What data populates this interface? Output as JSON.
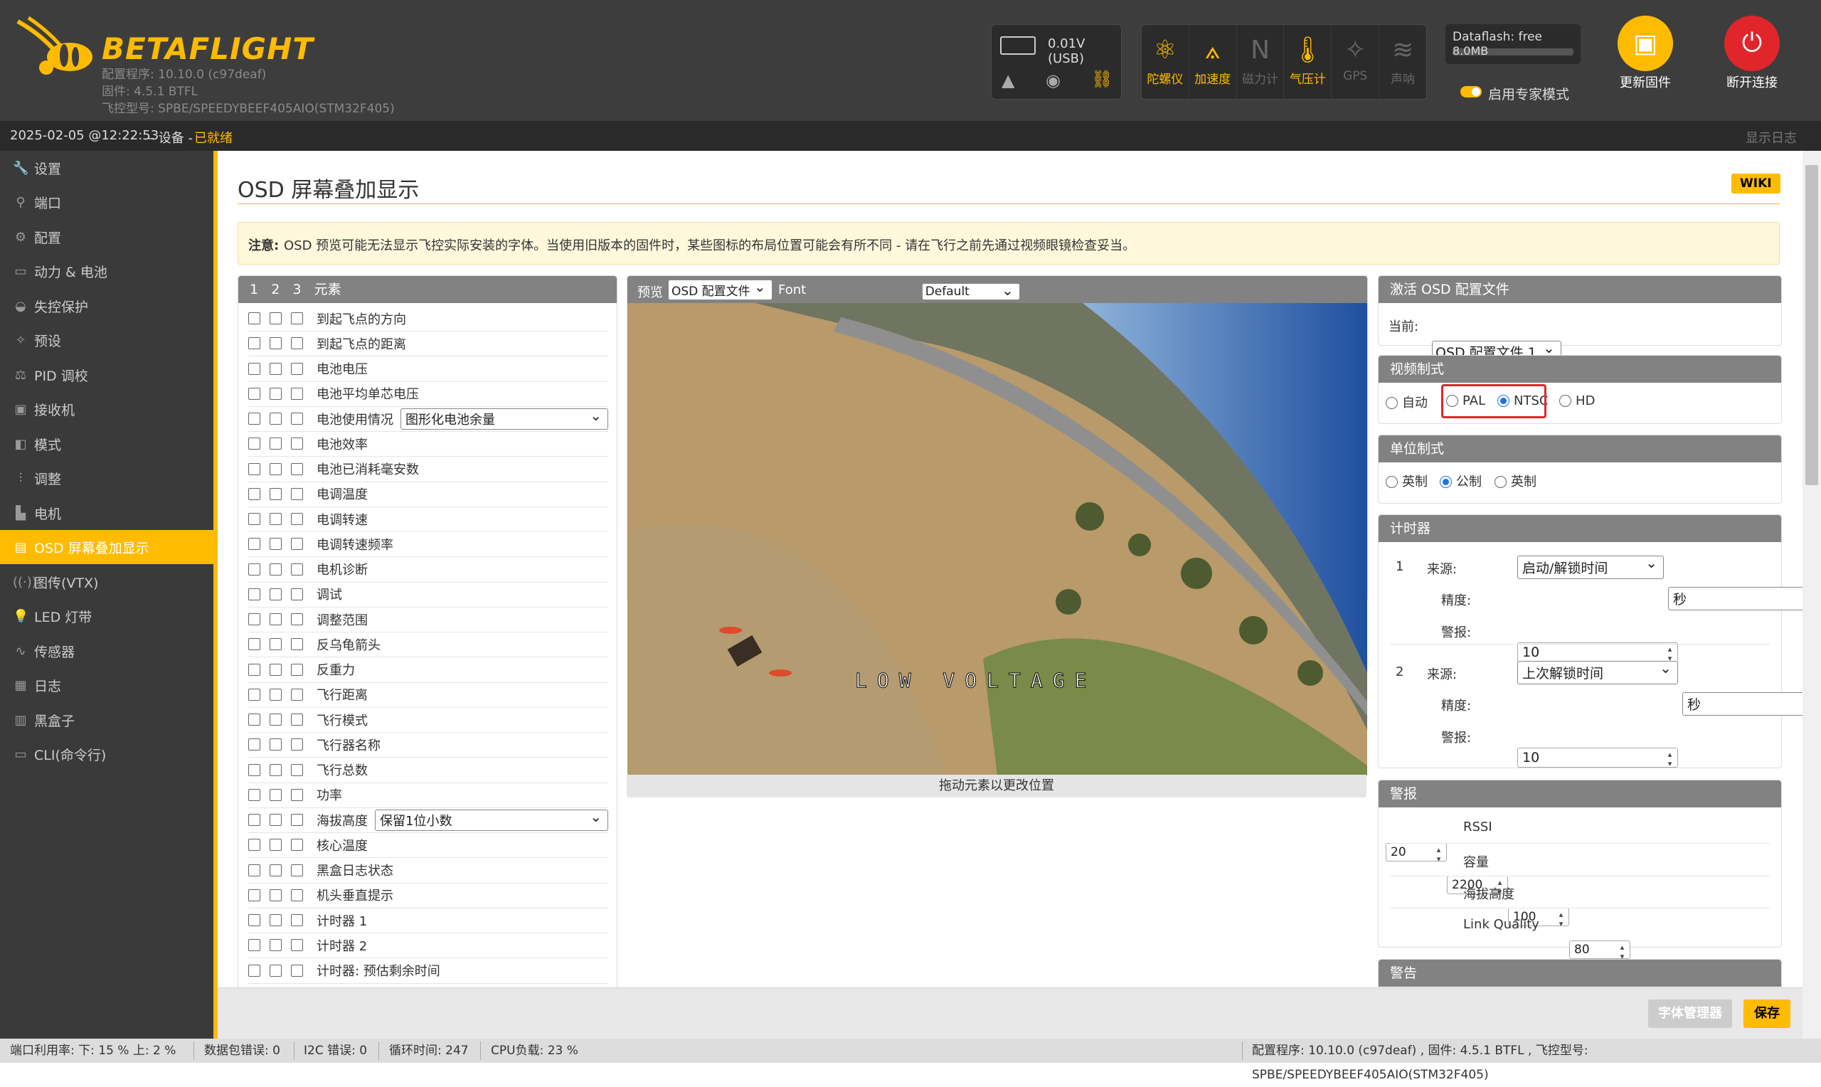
{
  "app": {
    "logo_text": "BETAFLIGHT",
    "configurator_version": "配置程序: 10.10.0 (c97deaf)",
    "firmware": "固件: 4.5.1 BTFL",
    "board": "飞控型号: SPBE/SPEEDYBEEF405AIO(STM32F405)"
  },
  "header": {
    "battery_voltage": "0.01V (USB)",
    "sensors": [
      {
        "label": "陀螺仪",
        "icon": "gyro-icon",
        "active": true
      },
      {
        "label": "加速度",
        "icon": "accelerometer-icon",
        "active": true
      },
      {
        "label": "磁力计",
        "icon": "magnetometer-icon",
        "active": false
      },
      {
        "label": "气压计",
        "icon": "barometer-icon",
        "active": true
      },
      {
        "label": "GPS",
        "icon": "gps-icon",
        "active": false
      },
      {
        "label": "声呐",
        "icon": "sonar-icon",
        "active": false
      }
    ],
    "dataflash_label": "Dataflash: free",
    "dataflash_size": "8.0MB",
    "expert_mode_label": "启用专家模式",
    "update_firmware_label": "更新固件",
    "disconnect_label": "断开连接"
  },
  "statusline": {
    "datetime": "2025-02-05 @12:22:53",
    "separator": "– 设备 -",
    "state": "已就绪",
    "show_log": "显示日志"
  },
  "sidebar": {
    "items": [
      {
        "label": "设置",
        "icon": "wrench-icon"
      },
      {
        "label": "端口",
        "icon": "plug-icon"
      },
      {
        "label": "配置",
        "icon": "gear-icon"
      },
      {
        "label": "动力 & 电池",
        "icon": "battery-icon"
      },
      {
        "label": "失控保护",
        "icon": "parachute-icon"
      },
      {
        "label": "预设",
        "icon": "magic-icon"
      },
      {
        "label": "PID 调校",
        "icon": "sliders-icon"
      },
      {
        "label": "接收机",
        "icon": "receiver-icon"
      },
      {
        "label": "模式",
        "icon": "modes-icon"
      },
      {
        "label": "调整",
        "icon": "adjust-icon"
      },
      {
        "label": "电机",
        "icon": "motor-icon"
      },
      {
        "label": "OSD 屏幕叠加显示",
        "icon": "osd-icon",
        "active": true
      },
      {
        "label": "图传(VTX)",
        "icon": "vtx-icon"
      },
      {
        "label": "LED 灯带",
        "icon": "led-icon"
      },
      {
        "label": "传感器",
        "icon": "sensors-icon"
      },
      {
        "label": "日志",
        "icon": "log-icon"
      },
      {
        "label": "黑盒子",
        "icon": "blackbox-icon"
      },
      {
        "label": "CLI(命令行)",
        "icon": "cli-icon"
      }
    ]
  },
  "page": {
    "title": "OSD 屏幕叠加显示",
    "wiki": "WIKI",
    "note_bold": "注意:",
    "note_text": "OSD 预览可能无法显示飞控实际安装的字体。当使用旧版本的固件时，某些图标的布局位置可能会有所不同 - 请在飞行之前先通过视频眼镜检查妥当。"
  },
  "elements": {
    "tabs": [
      "1",
      "2",
      "3"
    ],
    "header": "元素",
    "rows": [
      {
        "label": "到起飞点的方向"
      },
      {
        "label": "到起飞点的距离"
      },
      {
        "label": "电池电压"
      },
      {
        "label": "电池平均单芯电压"
      },
      {
        "label": "电池使用情况",
        "select": "图形化电池余量"
      },
      {
        "label": "电池效率"
      },
      {
        "label": "电池已消耗毫安数"
      },
      {
        "label": "电调温度"
      },
      {
        "label": "电调转速"
      },
      {
        "label": "电调转速频率"
      },
      {
        "label": "电机诊断"
      },
      {
        "label": "调试"
      },
      {
        "label": "调整范围"
      },
      {
        "label": "反乌龟箭头"
      },
      {
        "label": "反重力"
      },
      {
        "label": "飞行距离"
      },
      {
        "label": "飞行模式"
      },
      {
        "label": "飞行器名称"
      },
      {
        "label": "飞行总数"
      },
      {
        "label": "功率"
      },
      {
        "label": "海拔高度",
        "select": "保留1位小数"
      },
      {
        "label": "核心温度"
      },
      {
        "label": "黑盒日志状态"
      },
      {
        "label": "机头垂直提示"
      },
      {
        "label": "计时器 1"
      },
      {
        "label": "计时器 2"
      },
      {
        "label": "计时器: 预估剩余时间"
      }
    ]
  },
  "preview": {
    "label": "预览",
    "profile": "OSD 配置文件",
    "font_label": "Font",
    "font": "Default",
    "osd_text": "LOW VOLTAGE",
    "footer": "拖动元素以更改位置"
  },
  "profile": {
    "title": "激活 OSD 配置文件",
    "current_label": "当前:",
    "current": "OSD 配置文件 1"
  },
  "video": {
    "title": "视频制式",
    "options": [
      "自动",
      "PAL",
      "NTSC",
      "HD"
    ],
    "selected": "NTSC"
  },
  "units": {
    "title": "单位制式",
    "options": [
      "英制",
      "公制",
      "英制"
    ],
    "selected_index": 1
  },
  "timers": {
    "title": "计时器",
    "items": [
      {
        "index": "1",
        "source_label": "来源:",
        "source": "启动/解锁时间",
        "precision_label": "精度:",
        "precision": "秒",
        "alarm_label": "警报:",
        "alarm": "10"
      },
      {
        "index": "2",
        "source_label": "来源:",
        "source": "上次解锁时间",
        "precision_label": "精度:",
        "precision": "秒",
        "alarm_label": "警报:",
        "alarm": "10"
      }
    ]
  },
  "alarms": {
    "title": "警报",
    "items": [
      {
        "value": "20",
        "label": "RSSI"
      },
      {
        "value": "2200",
        "label": "容量"
      },
      {
        "value": "100",
        "label": "海拔高度"
      },
      {
        "value": "80",
        "label": "Link Quality"
      }
    ]
  },
  "warnings": {
    "title": "警告"
  },
  "buttons": {
    "font_manager": "字体管理器",
    "save": "保存"
  },
  "footer": {
    "port_util": "端口利用率:  下: 15 % 上: 2 %",
    "packet_errors": "数据包错误: 0",
    "i2c_errors": "I2C 错误: 0",
    "cycle_time": "循环时间: 247",
    "cpu_load": "CPU负载: 23 %",
    "version_info": "配置程序: 10.10.0 (c97deaf) , 固件: 4.5.1 BTFL , 飞控型号: SPBE/SPEEDYBEEF405AIO(STM32F405)"
  },
  "colors": {
    "accent": "#ffbb00",
    "danger": "#e0262b",
    "highlight_box": "#e0262b"
  }
}
